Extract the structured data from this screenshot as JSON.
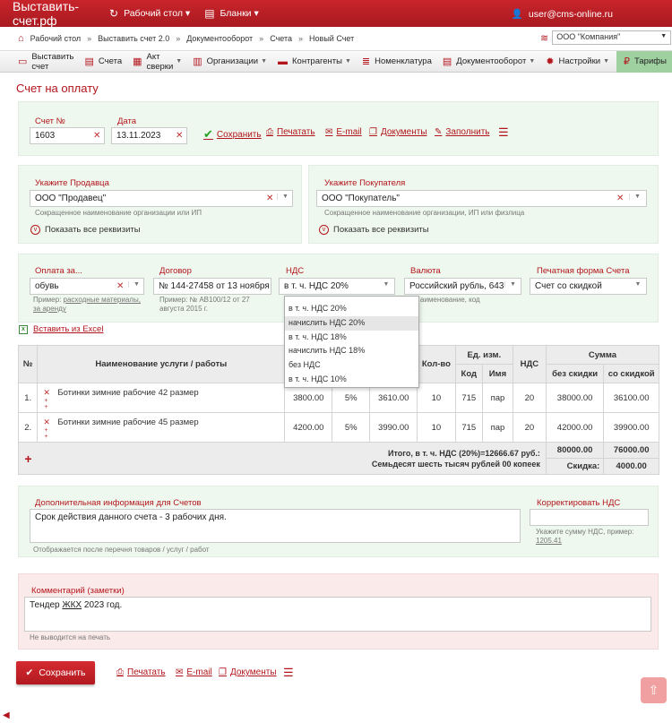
{
  "app": {
    "brand": "Выставить-счет.рф",
    "nav_desk": "Рабочий стол",
    "nav_forms": "Бланки",
    "user": "user@cms-online.ru"
  },
  "breadcrumb": {
    "items": [
      "Рабочий стол",
      "Выставить счет 2.0",
      "Документооборот",
      "Счета",
      "Новый Счет"
    ]
  },
  "company": {
    "selected": "ООО \"Компания\""
  },
  "menu": [
    "Выставить счет",
    "Счета",
    "Акт сверки",
    "Организации",
    "Контрагенты",
    "Номенклатура",
    "Документооборот",
    "Настройки",
    "Тарифы"
  ],
  "page": {
    "title": "Счет на оплату"
  },
  "invoice": {
    "number_label": "Счет №",
    "number": "1603",
    "date_label": "Дата",
    "date": "13.11.2023",
    "actions": [
      "Сохранить",
      "Печатать",
      "E-mail",
      "Документы",
      "Заполнить"
    ]
  },
  "seller": {
    "label": "Укажите Продавца",
    "value": "ООО \"Продавец\"",
    "hint": "Сокращенное наименование организации или ИП",
    "show_all": "Показать все реквизиты"
  },
  "buyer": {
    "label": "Укажите Покупателя",
    "value": "ООО \"Покупатель\"",
    "hint": "Сокращенное наименование организации, ИП или физлица",
    "show_all": "Показать все реквизиты"
  },
  "terms": {
    "payment_label": "Оплата за...",
    "payment_value": "обувь",
    "payment_hint_prefix": "Пример:",
    "payment_hint_example": "расходные материалы, за аренду",
    "contract_label": "Договор",
    "contract_value": "№ 144-27458 от 13 ноября",
    "contract_hint": "Пример: № АВ100/12 от 27 августа 2015 г.",
    "vat_label": "НДС",
    "vat_value": "в т. ч. НДС 20%",
    "currency_label": "Валюта",
    "currency_value": "Российский рубль, 643",
    "currency_hint": "аименование, код",
    "print_label": "Печатная форма Счета",
    "print_value": "Счет со скидкой"
  },
  "vat_options": [
    "в т. ч. НДС 20%",
    "начислить НДС 20%",
    "в т. ч. НДС 18%",
    "начислить НДС 18%",
    "без НДС",
    "в т. ч. НДС 10%"
  ],
  "import_excel": "Вставить из Excel",
  "table": {
    "h_num": "№",
    "h_name": "Наименование услуги / работы",
    "h_qty": "Кол-во",
    "h_unit": "Ед. изм.",
    "h_code": "Код",
    "h_uname": "Имя",
    "h_vat": "НДС",
    "h_sum": "Сумма",
    "h_nodisc": "без скидки",
    "h_disc": "со скидкой",
    "rows": [
      {
        "n": "1.",
        "name": "Ботинки зимние рабочие 42 размер",
        "price": "3800.00",
        "discount": "5%",
        "price_disc": "3610.00",
        "qty": "10",
        "code": "715",
        "unit": "пар",
        "vat": "20",
        "sum": "38000.00",
        "sum_disc": "36100.00"
      },
      {
        "n": "2.",
        "name": "Ботинки зимние рабочие 45 размер",
        "price": "4200.00",
        "discount": "5%",
        "price_disc": "3990.00",
        "qty": "10",
        "code": "715",
        "unit": "пар",
        "vat": "20",
        "sum": "42000.00",
        "sum_disc": "39900.00"
      }
    ],
    "total_line1": "Итого, в т. ч. НДС (20%)=12666.67 руб.:",
    "total_line2": "Семьдесят шесть тысяч рублей 00 копеек",
    "total": "80000.00",
    "total_disc": "76000.00",
    "discount_label": "Скидка:",
    "discount_total": "4000.00"
  },
  "extra": {
    "label": "Дополнительная информация для Счетов",
    "value": "Срок действия данного счета - 3 рабочих дня.",
    "hint": "Отображается после перечня товаров / услуг / работ",
    "vat_fix_label": "Корректировать НДС",
    "vat_fix_hint_prefix": "Укажите сумму НДС, пример:",
    "vat_fix_hint_example": "1205.41"
  },
  "comment": {
    "label": "Комментарий (заметки)",
    "value_pre": "Тендер ",
    "value_u": "ЖКХ",
    "value_post": " 2023 год.",
    "hint": "Не выводится на печать"
  },
  "bottom": {
    "save": "Сохранить",
    "print": "Печатать",
    "email": "E-mail",
    "docs": "Документы"
  },
  "colors": {
    "brand_red": "#b3151c",
    "panel_green": "#eef8ee",
    "panel_pink": "#fbeaea"
  }
}
